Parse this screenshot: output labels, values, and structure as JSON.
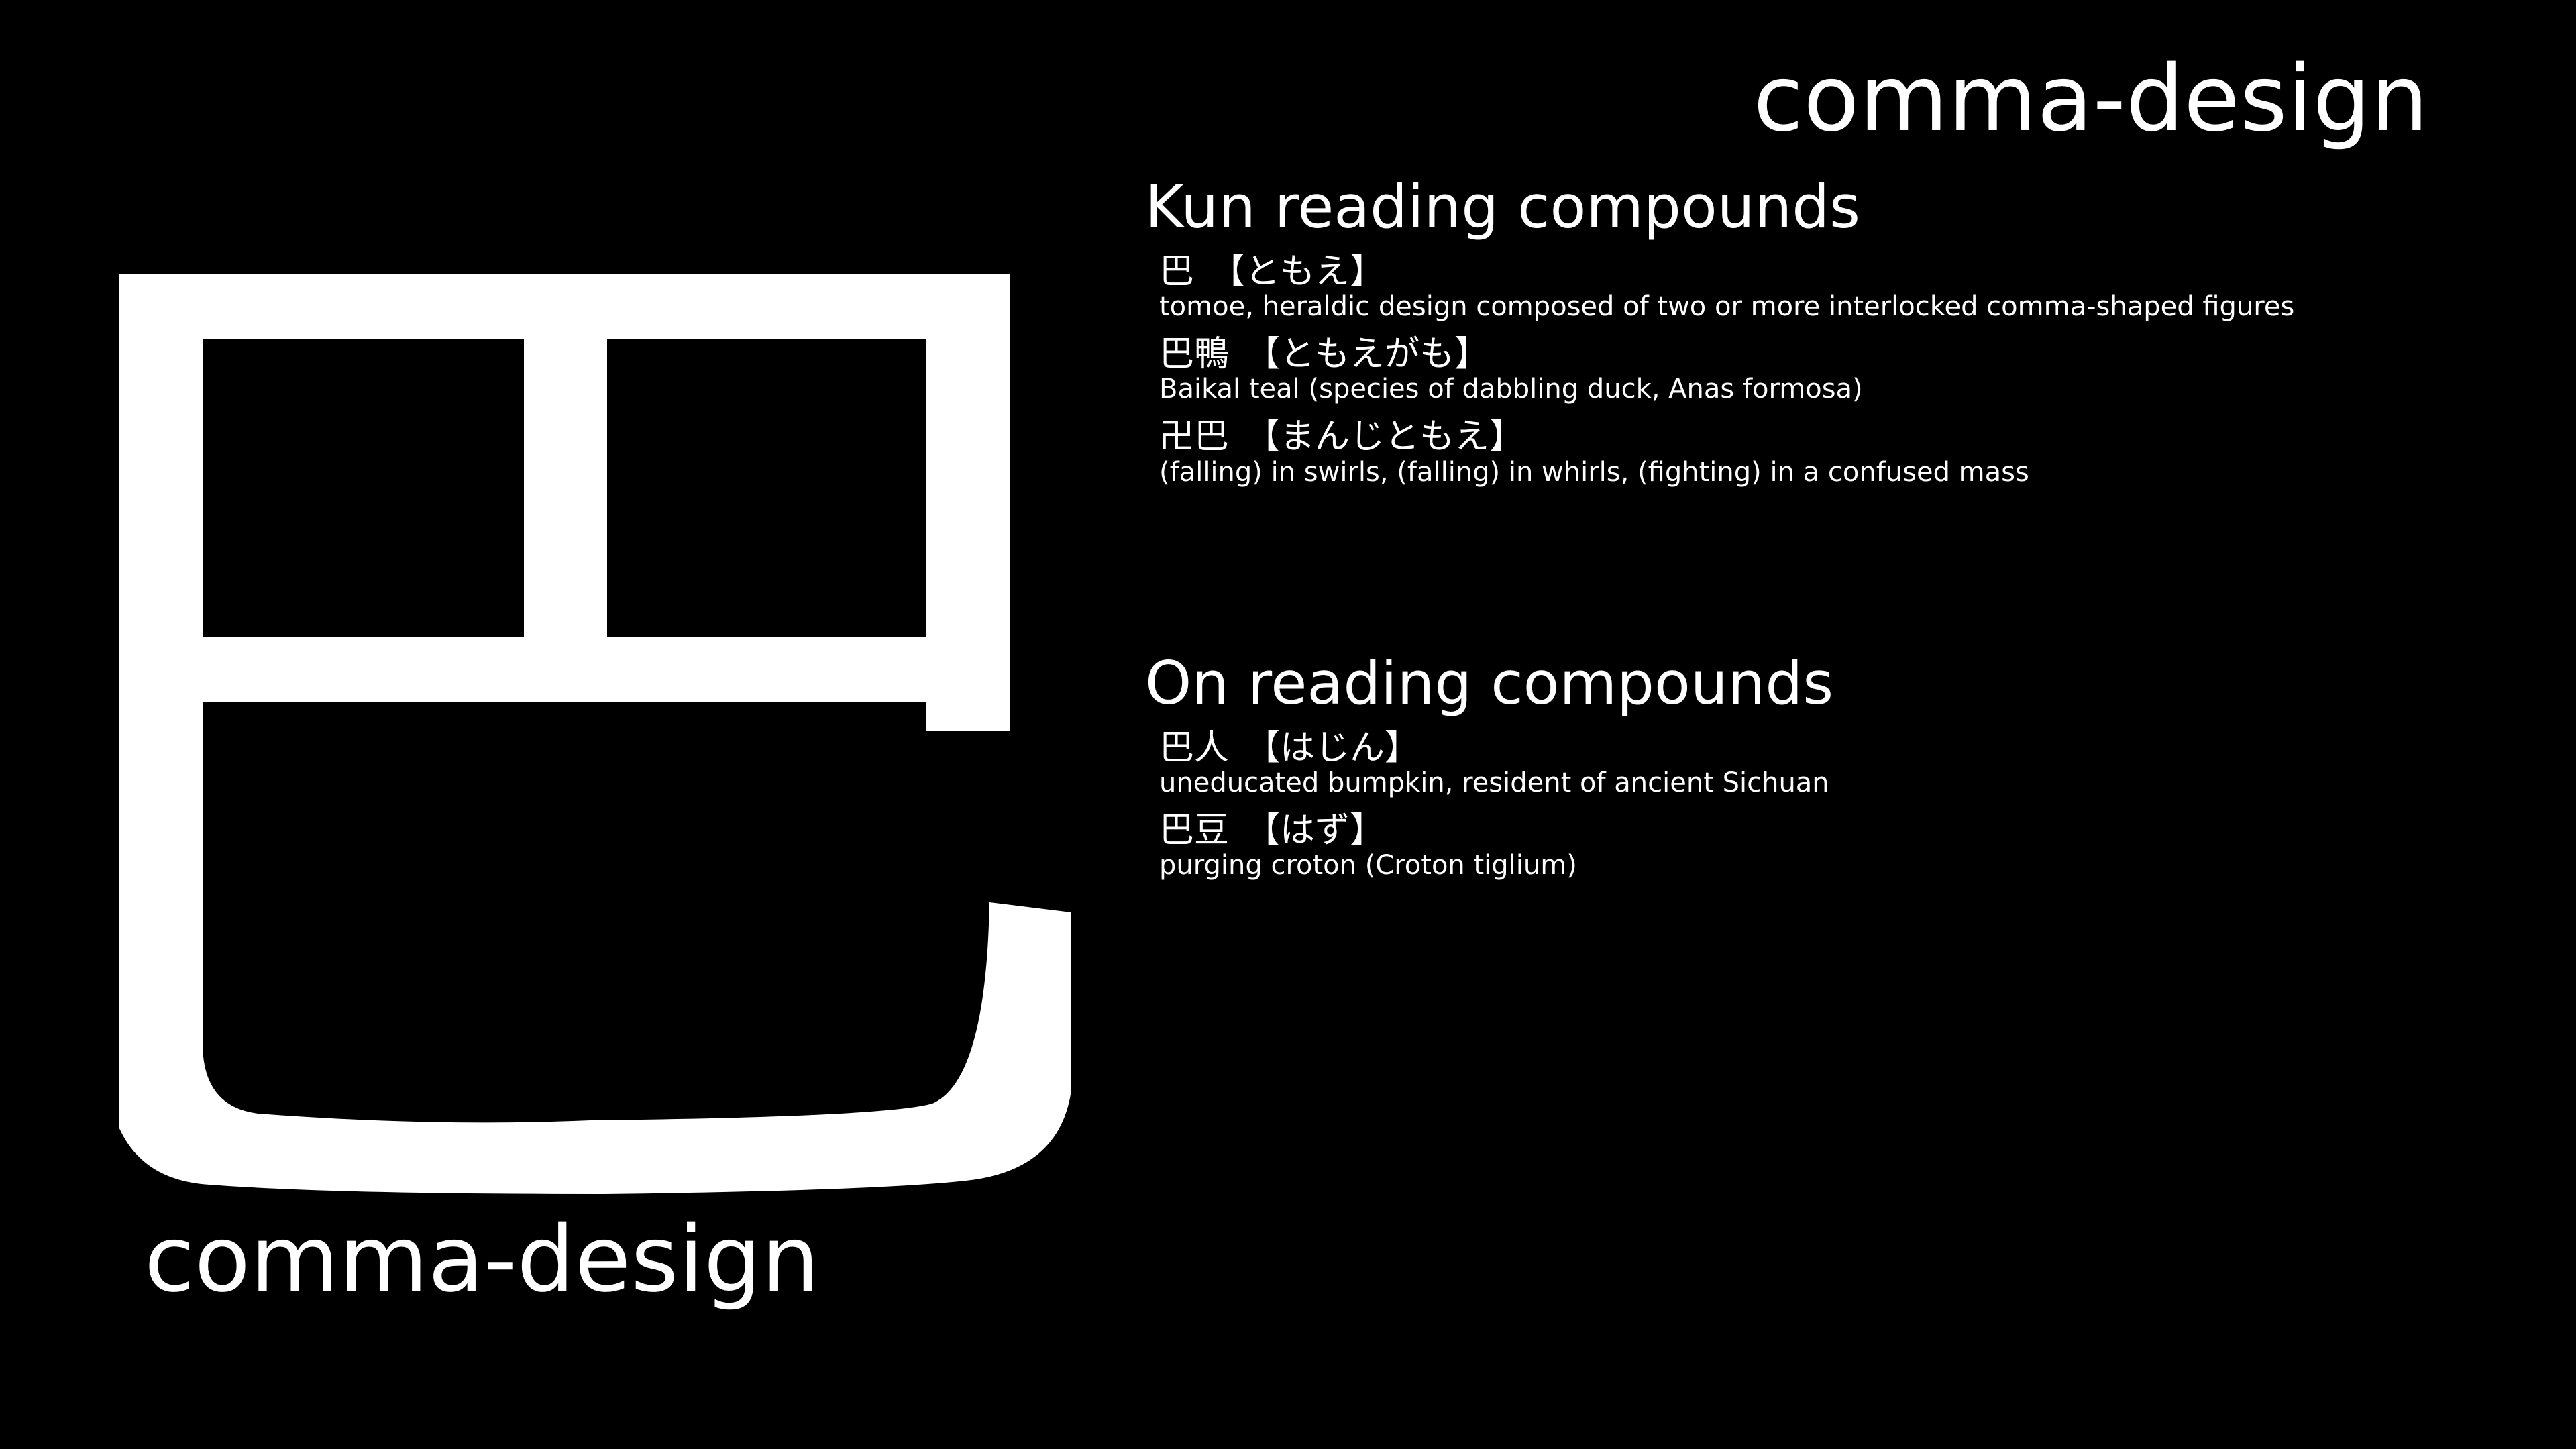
{
  "kanji": {
    "character": "巴",
    "color": "#ffffff"
  },
  "meaning_large": "comma-design",
  "meaning_corner": "comma-design",
  "kun_section": {
    "title": "Kun reading compounds",
    "entries": [
      {
        "word": "巴",
        "reading": "【ともえ】",
        "gloss": "tomoe, heraldic design composed of two or more interlocked comma-shaped figures"
      },
      {
        "word": "巴鴨",
        "reading": "【ともえがも】",
        "gloss": "Baikal teal (species of dabbling duck, Anas formosa)"
      },
      {
        "word": "卍巴",
        "reading": "【まんじともえ】",
        "gloss": "(falling) in swirls, (falling) in whirls, (fighting) in a confused mass"
      }
    ]
  },
  "on_section": {
    "title": "On reading compounds",
    "entries": [
      {
        "word": "巴人",
        "reading": "【はじん】",
        "gloss": "uneducated bumpkin, resident of ancient Sichuan"
      },
      {
        "word": "巴豆",
        "reading": "【はず】",
        "gloss": "purging croton (Croton tiglium)"
      }
    ]
  },
  "colors": {
    "background": "#000000",
    "foreground": "#ffffff"
  }
}
